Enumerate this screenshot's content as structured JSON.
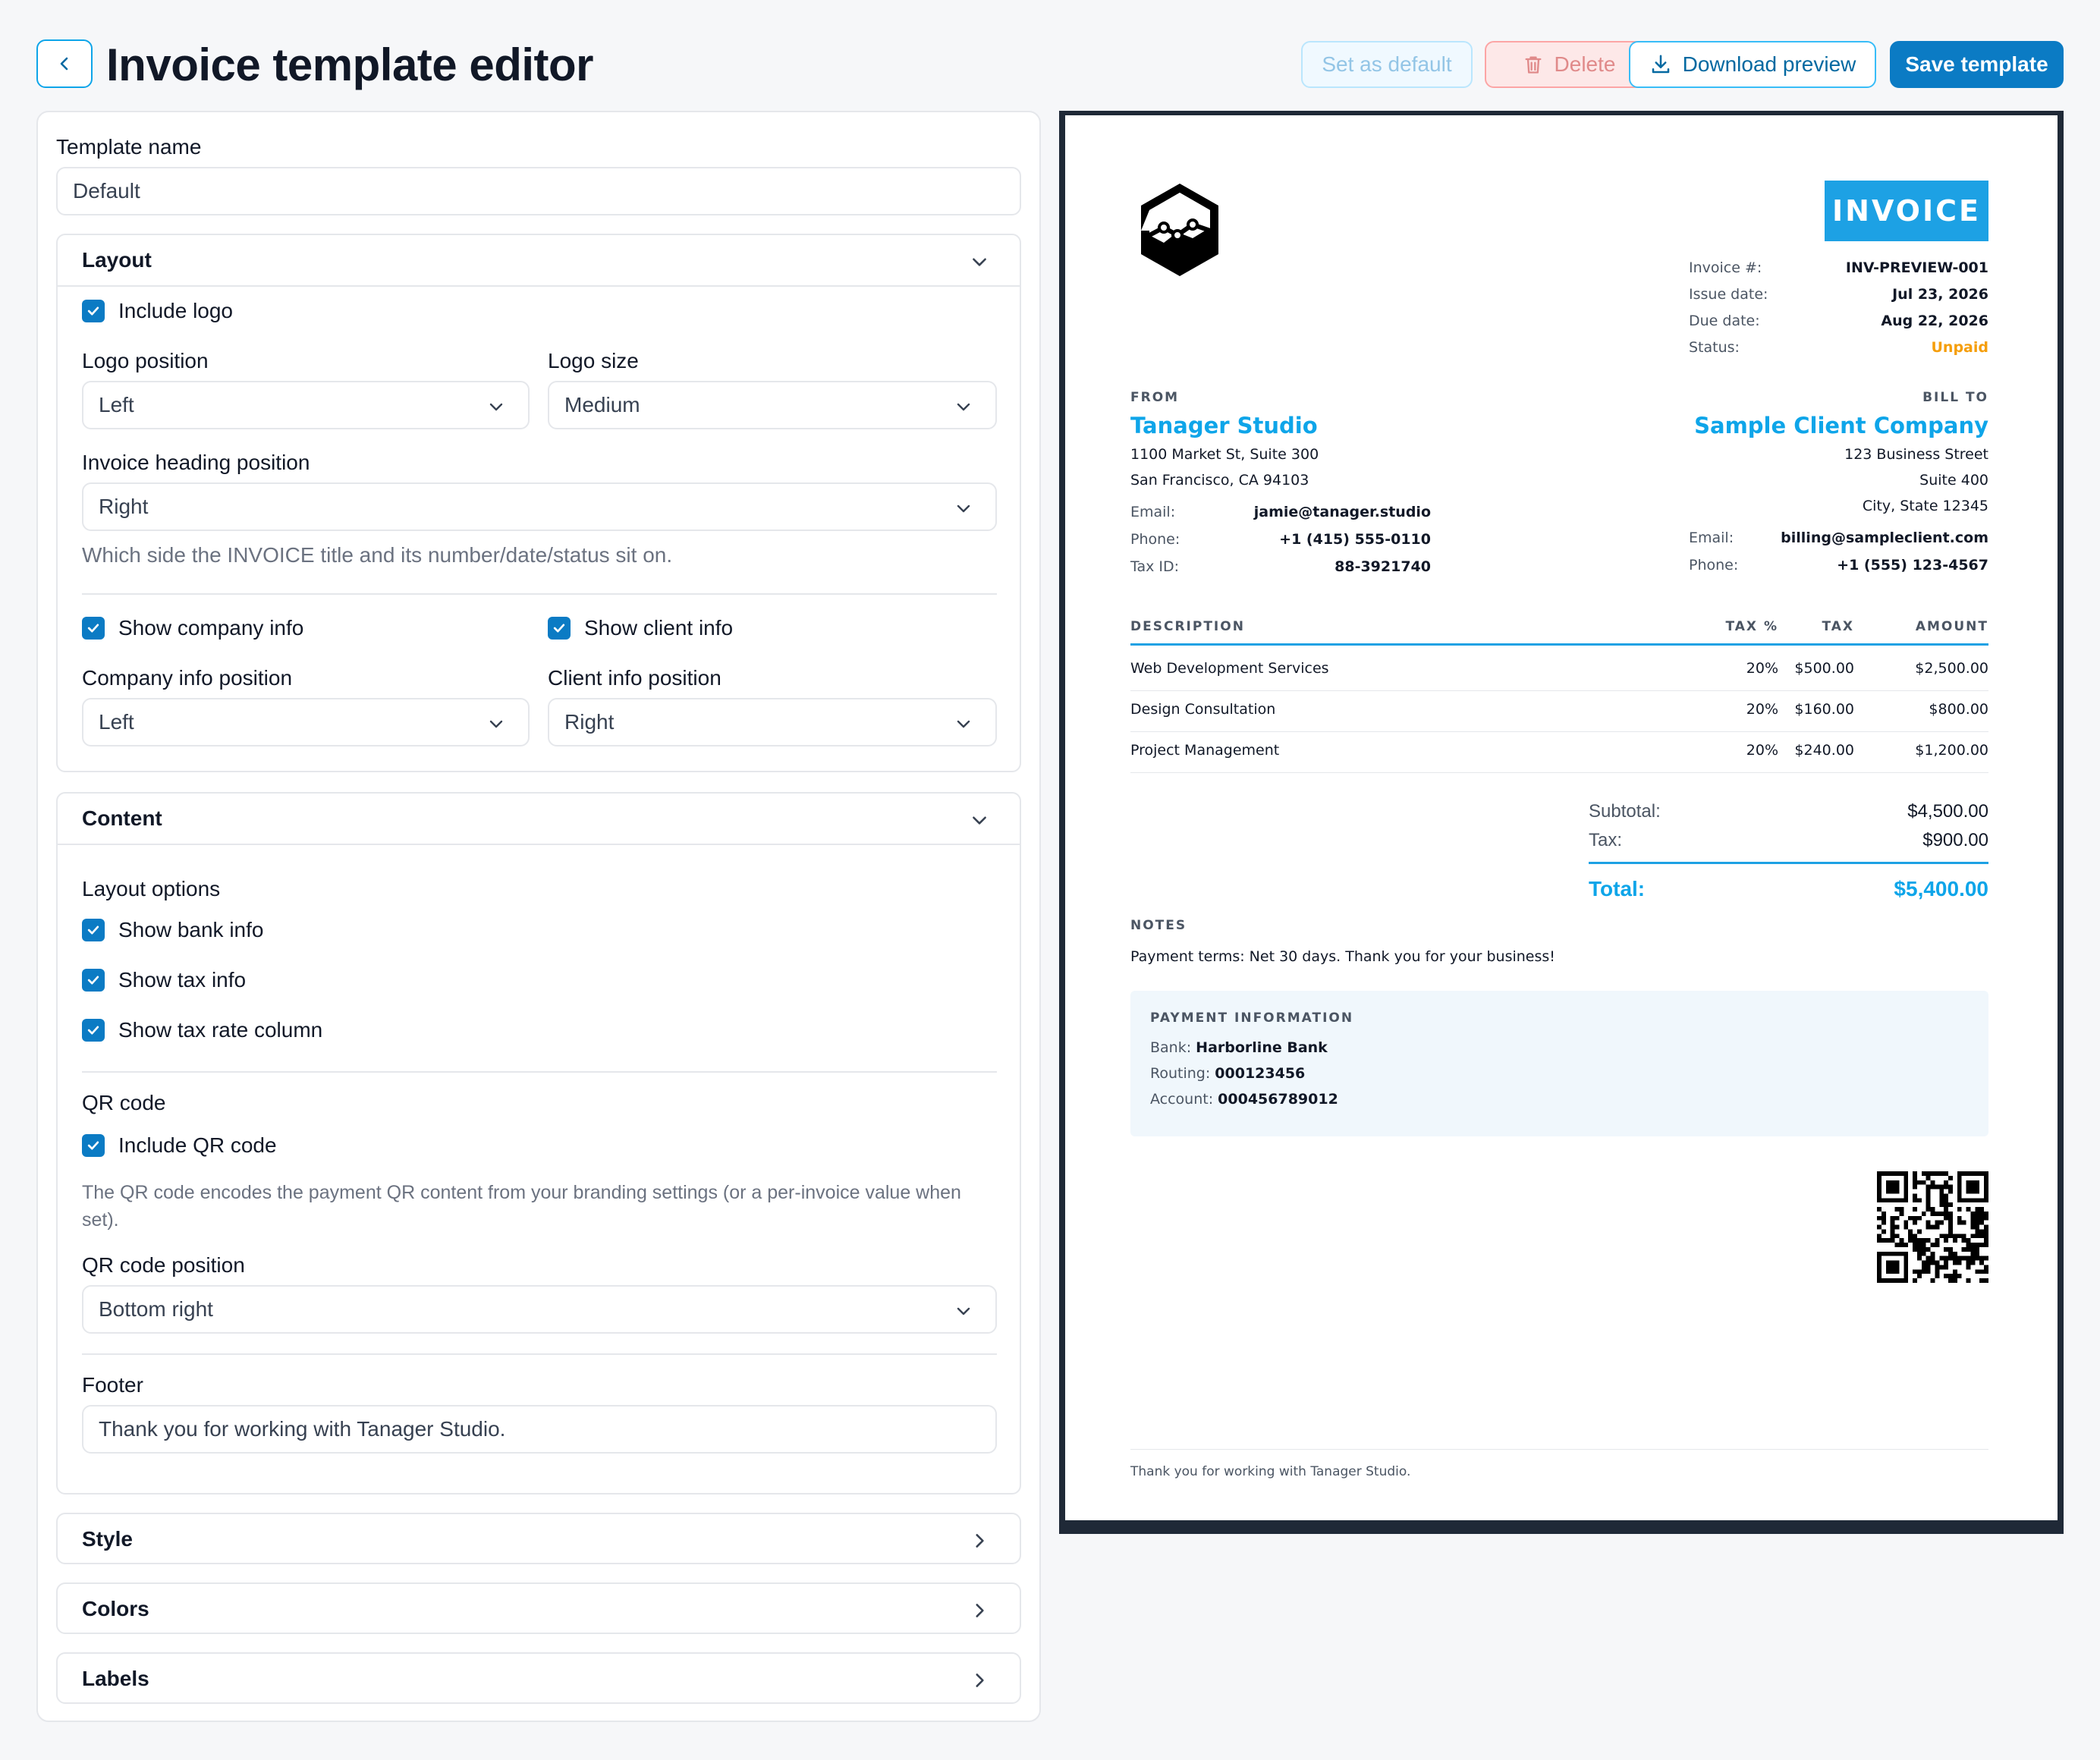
{
  "header": {
    "title": "Invoice template editor",
    "set_default": "Set as default",
    "delete": "Delete",
    "download": "Download preview",
    "save": "Save template"
  },
  "form": {
    "template_name_label": "Template name",
    "template_name_value": "Default",
    "layout": {
      "title": "Layout",
      "include_logo": "Include logo",
      "logo_position_label": "Logo position",
      "logo_position_value": "Left",
      "logo_size_label": "Logo size",
      "logo_size_value": "Medium",
      "heading_position_label": "Invoice heading position",
      "heading_position_value": "Right",
      "heading_help": "Which side the INVOICE title and its number/date/status sit on.",
      "show_company_info": "Show company info",
      "show_client_info": "Show client info",
      "company_position_label": "Company info position",
      "company_position_value": "Left",
      "client_position_label": "Client info position",
      "client_position_value": "Right"
    },
    "content": {
      "title": "Content",
      "layout_options": "Layout options",
      "show_bank_info": "Show bank info",
      "show_tax_info": "Show tax info",
      "show_tax_rate_column": "Show tax rate column",
      "qr_heading": "QR code",
      "include_qr": "Include QR code",
      "qr_help": "The QR code encodes the payment QR content from your branding settings (or a per-invoice value when set).",
      "qr_position_label": "QR code position",
      "qr_position_value": "Bottom right",
      "footer_label": "Footer",
      "footer_value": "Thank you for working with Tanager Studio."
    },
    "collapsed_sections": [
      "Style",
      "Colors",
      "Labels"
    ]
  },
  "invoice": {
    "badge": "INVOICE",
    "meta": [
      {
        "label": "Invoice #:",
        "value": "INV-PREVIEW-001"
      },
      {
        "label": "Issue date:",
        "value": "Jul 23, 2026"
      },
      {
        "label": "Due date:",
        "value": "Aug 22, 2026"
      },
      {
        "label": "Status:",
        "value": "Unpaid"
      }
    ],
    "from": {
      "caption": "FROM",
      "name": "Tanager Studio",
      "address1": "1100 Market St, Suite 300",
      "address2": "San Francisco, CA 94103",
      "email_label": "Email:",
      "email": "jamie@tanager.studio",
      "phone_label": "Phone:",
      "phone": "+1 (415) 555-0110",
      "tax_label": "Tax ID:",
      "tax_id": "88-3921740"
    },
    "bill_to": {
      "caption": "BILL TO",
      "name": "Sample Client Company",
      "address1": "123 Business Street",
      "address2": "Suite 400",
      "address3": "City, State 12345",
      "email_label": "Email:",
      "email": "billing@sampleclient.com",
      "phone_label": "Phone:",
      "phone": "+1 (555) 123-4567"
    },
    "table_headers": {
      "description": "DESCRIPTION",
      "tax_rate": "TAX %",
      "tax": "TAX",
      "amount": "AMOUNT"
    },
    "items": [
      {
        "description": "Web Development Services",
        "tax_rate": "20%",
        "tax": "$500.00",
        "amount": "$2,500.00"
      },
      {
        "description": "Design Consultation",
        "tax_rate": "20%",
        "tax": "$160.00",
        "amount": "$800.00"
      },
      {
        "description": "Project Management",
        "tax_rate": "20%",
        "tax": "$240.00",
        "amount": "$1,200.00"
      }
    ],
    "totals": {
      "subtotal_label": "Subtotal:",
      "subtotal": "$4,500.00",
      "tax_label": "Tax:",
      "tax": "$900.00",
      "total_label": "Total:",
      "total": "$5,400.00"
    },
    "notes": {
      "caption": "NOTES",
      "text": "Payment terms: Net 30 days. Thank you for your business!"
    },
    "payment": {
      "caption": "PAYMENT INFORMATION",
      "bank_label": "Bank:",
      "bank": "Harborline Bank",
      "routing_label": "Routing:",
      "routing": "000123456",
      "account_label": "Account:",
      "account": "000456789012"
    },
    "footer": "Thank you for working with Tanager Studio."
  },
  "colors": {
    "accent": "#0b7bc4",
    "invoice_blue": "#1da1e4",
    "status_unpaid": "#f59e0b"
  }
}
